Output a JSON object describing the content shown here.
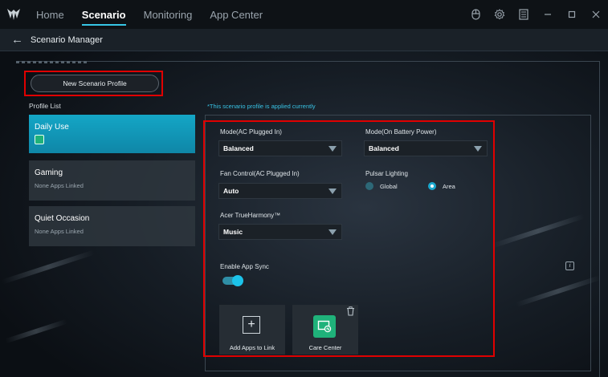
{
  "nav": {
    "tabs": [
      {
        "label": "Home",
        "active": false
      },
      {
        "label": "Scenario",
        "active": true
      },
      {
        "label": "Monitoring",
        "active": false
      },
      {
        "label": "App Center",
        "active": false
      }
    ],
    "icons": [
      "mouse-icon",
      "settings-icon",
      "notes-icon",
      "minimize-icon",
      "maximize-icon",
      "close-icon"
    ]
  },
  "breadcrumb": {
    "title": "Scenario Manager"
  },
  "new_profile_label": "New Scenario Profile",
  "profile_list_label": "Profile List",
  "applied_note": "*This scenario profile is applied currently",
  "profiles": [
    {
      "name": "Daily Use",
      "sub": "",
      "active": true
    },
    {
      "name": "Gaming",
      "sub": "None Apps Linked",
      "active": false
    },
    {
      "name": "Quiet Occasion",
      "sub": "None Apps Linked",
      "active": false
    }
  ],
  "settings": {
    "mode_ac_label": "Mode(AC Plugged In)",
    "mode_ac_value": "Balanced",
    "mode_battery_label": "Mode(On Battery Power)",
    "mode_battery_value": "Balanced",
    "fan_label": "Fan Control(AC Plugged In)",
    "fan_value": "Auto",
    "pulsar_label": "Pulsar Lighting",
    "pulsar_options": [
      "Global",
      "Area"
    ],
    "pulsar_selected": "Area",
    "trueharmony_label": "Acer TrueHarmony™",
    "trueharmony_value": "Music",
    "app_sync_label": "Enable App Sync",
    "app_sync_enabled": true
  },
  "apps": {
    "add_label": "Add Apps to Link",
    "linked": [
      {
        "name": "Care Center",
        "icon": "care-center-icon"
      }
    ]
  },
  "colors": {
    "accent": "#37c6e6",
    "highlight_border": "#e00000",
    "active_profile": "#14a6c6",
    "app_icon": "#1fb27a"
  }
}
